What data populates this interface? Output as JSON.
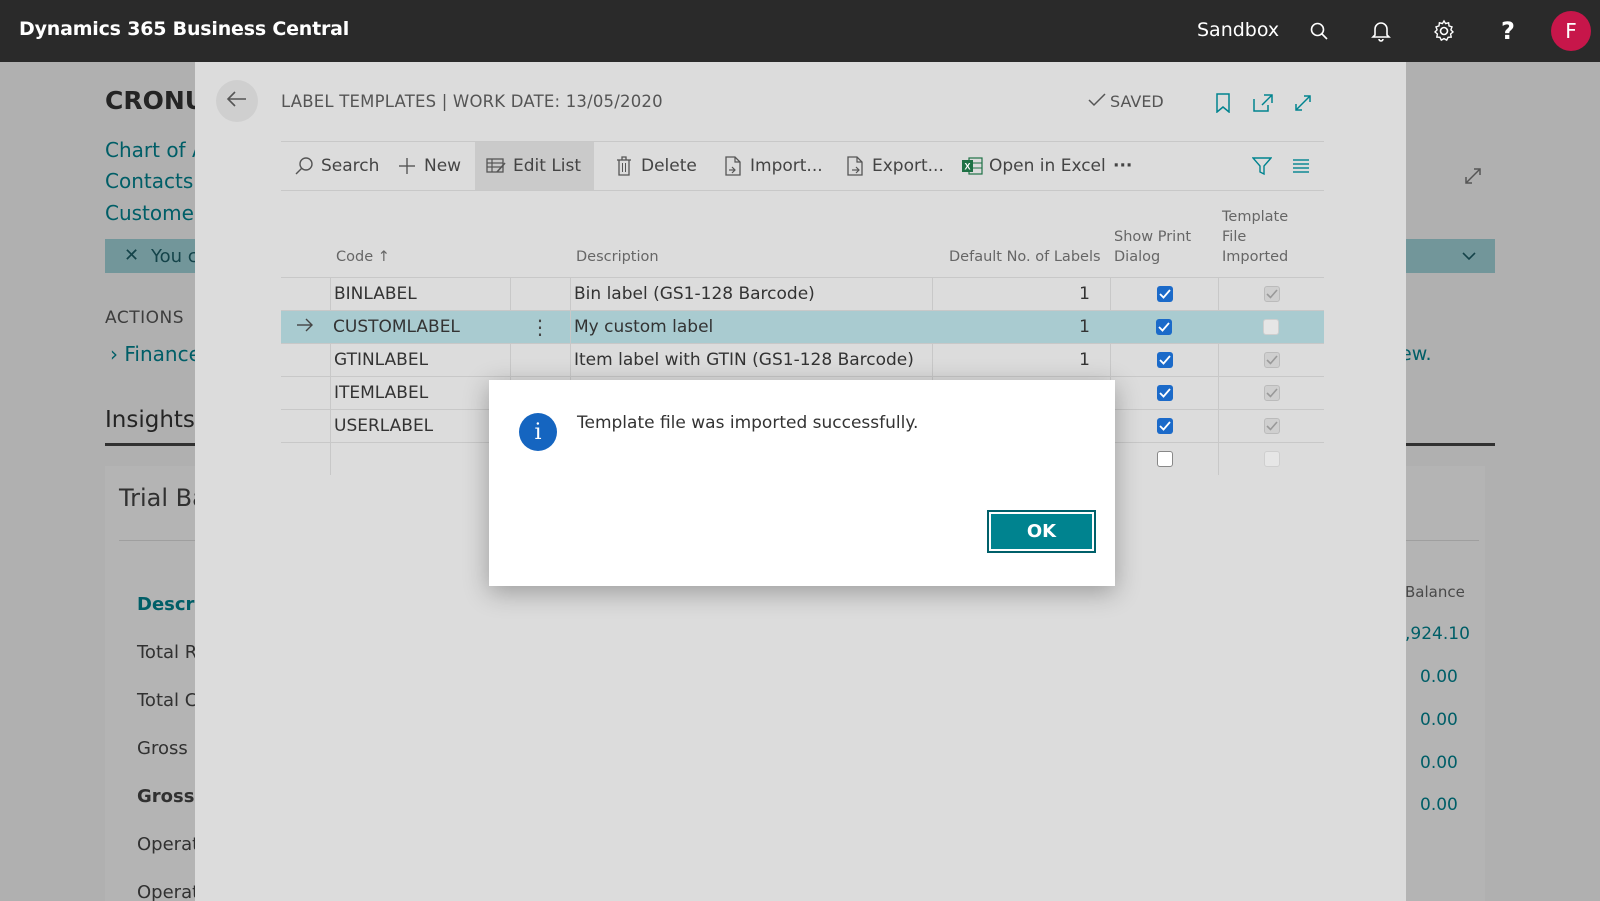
{
  "topbar": {
    "app_title": "Dynamics 365 Business Central",
    "environment": "Sandbox",
    "avatar_initial": "F"
  },
  "background": {
    "company": "CRONUS",
    "nav_links": [
      "Chart of A",
      "Contacts",
      "Customers"
    ],
    "banner_text": "You c",
    "actions_label": "ACTIONS",
    "finance_label": "Finance",
    "new_label": "ew.",
    "insights_label": "Insights",
    "card_title": "Trial Ba",
    "rows": [
      "Descrip",
      "Total Re",
      "Total Co",
      "Gross M",
      "Gross M",
      "Operati",
      "Operati"
    ],
    "balance_header": "Balance",
    "balance_values": [
      ",924.10",
      "0.00",
      "0.00",
      "0.00",
      "0.00"
    ]
  },
  "panel": {
    "title": "LABEL TEMPLATES | WORK DATE: 13/05/2020",
    "saved_label": "SAVED",
    "toolbar": {
      "search": "Search",
      "new": "New",
      "edit_list": "Edit List",
      "delete": "Delete",
      "import": "Import...",
      "export": "Export...",
      "open_excel": "Open in Excel",
      "more": "···"
    },
    "columns": {
      "code": "Code",
      "description": "Description",
      "default_labels": "Default No. of Labels",
      "show_print_line1": "Show Print",
      "show_print_line2": "Dialog",
      "tpl_line1": "Template",
      "tpl_line2": "File",
      "tpl_line3": "Imported"
    },
    "rows": [
      {
        "code": "BINLABEL",
        "description": "Bin label (GS1-128 Barcode)",
        "labels": "1",
        "show_print": true,
        "imported": true
      },
      {
        "code": "CUSTOMLABEL",
        "description": "My custom label",
        "labels": "1",
        "show_print": true,
        "imported": false
      },
      {
        "code": "GTINLABEL",
        "description": "Item label with GTIN (GS1-128 Barcode)",
        "labels": "1",
        "show_print": true,
        "imported": true
      },
      {
        "code": "ITEMLABEL",
        "description": "",
        "labels": "",
        "show_print": true,
        "imported": true
      },
      {
        "code": "USERLABEL",
        "description": "",
        "labels": "",
        "show_print": true,
        "imported": true
      },
      {
        "code": "",
        "description": "",
        "labels": "",
        "show_print": false,
        "imported": false
      }
    ]
  },
  "dialog": {
    "message": "Template file was imported successfully.",
    "ok_label": "OK"
  },
  "colors": {
    "topbar": "#2a2a2a",
    "accent": "#00838f",
    "selected_row": "#a9cbd0",
    "checkbox": "#1b6ac9",
    "avatar": "#c7164a"
  }
}
